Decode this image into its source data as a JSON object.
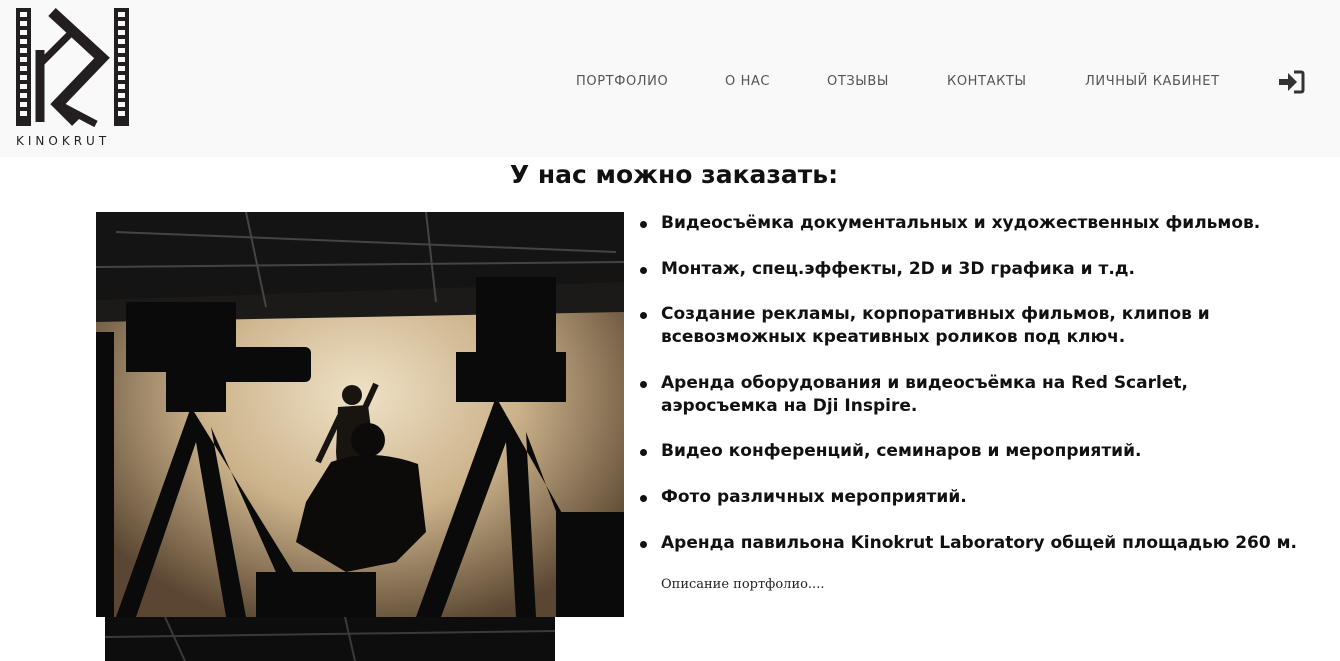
{
  "header": {
    "logo_text": "KINOKRUT",
    "nav": [
      {
        "label": "ПОРТФОЛИО"
      },
      {
        "label": "О НАС"
      },
      {
        "label": "ОТЗЫВЫ"
      },
      {
        "label": "КОНТАКТЫ"
      },
      {
        "label": "ЛИЧНЫЙ КАБИНЕТ"
      }
    ],
    "login_icon": "sign-in-icon"
  },
  "main": {
    "title": "У нас можно заказать:",
    "services": [
      {
        "lines": [
          "Видеосъёмка документальных и художественных фильмов."
        ]
      },
      {
        "lines": [
          "Монтаж, спец.эффекты, 2D и 3D графика и т.д."
        ]
      },
      {
        "lines": [
          "Создание рекламы, корпоративных фильмов, клипов и",
          "всевозможных креативных роликов под ключ."
        ]
      },
      {
        "lines": [
          "Аренда оборудования и видеосъёмка на Red Scarlet,",
          "аэросъемка на Dji Inspire."
        ]
      },
      {
        "lines": [
          "Видео конференций, семинаров и мероприятий."
        ]
      },
      {
        "lines": [
          "Фото различных мероприятий."
        ]
      },
      {
        "lines": [
          "Аренда павильона Kinokrut Laboratory общей площадью 260 м."
        ]
      }
    ],
    "description": "Описание портфолио...."
  },
  "colors": {
    "header_bg": "#f9f9f9",
    "logo": "#231f20",
    "nav_text": "#555555",
    "body_text": "#111111"
  }
}
